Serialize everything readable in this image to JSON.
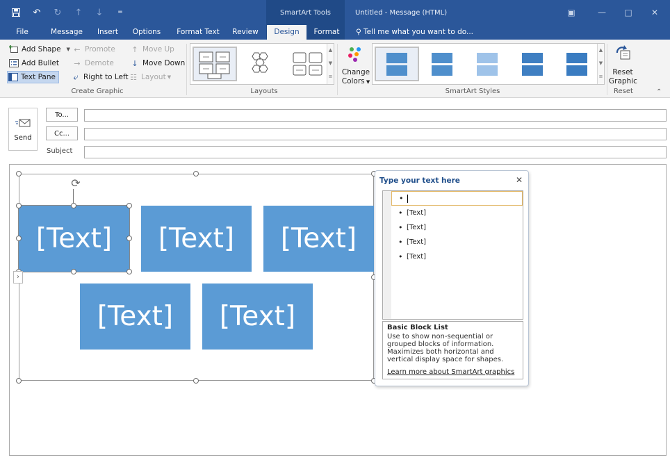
{
  "titlebar": {
    "contextual_title": "SmartArt Tools",
    "window_title": "Untitled - Message (HTML)",
    "qat": {
      "save_icon": "save-icon",
      "undo_icon": "undo-icon"
    }
  },
  "tabs": {
    "file": "File",
    "message": "Message",
    "insert": "Insert",
    "options": "Options",
    "format_text": "Format Text",
    "review": "Review",
    "design": "Design",
    "format": "Format",
    "tell_me": "Tell me what you want to do..."
  },
  "ribbon": {
    "create_graphic": {
      "label": "Create Graphic",
      "add_shape": "Add Shape",
      "add_bullet": "Add Bullet",
      "text_pane": "Text Pane",
      "promote": "Promote",
      "demote": "Demote",
      "right_to_left": "Right to Left",
      "move_up": "Move Up",
      "move_down": "Move Down",
      "layout": "Layout"
    },
    "layouts": {
      "label": "Layouts"
    },
    "smartart_styles": {
      "label": "SmartArt Styles",
      "change_colors_line1": "Change",
      "change_colors_line2": "Colors"
    },
    "reset": {
      "label": "Reset",
      "reset_graphic_line1": "Reset",
      "reset_graphic_line2": "Graphic"
    }
  },
  "message": {
    "send": "Send",
    "to_button": "To...",
    "cc_button": "Cc...",
    "subject_label": "Subject"
  },
  "smartart": {
    "blocks": [
      "[Text]",
      "[Text]",
      "[Text]",
      "[Text]",
      "[Text]"
    ],
    "color": "#5B9BD5"
  },
  "text_pane": {
    "title": "Type your text here",
    "items": [
      "",
      "[Text]",
      "[Text]",
      "[Text]",
      "[Text]"
    ],
    "layout_name": "Basic Block List",
    "layout_description": "Use to show non-sequential or grouped blocks of information. Maximizes both horizontal and vertical display space for shapes.",
    "learn_more": "Learn more about SmartArt graphics"
  }
}
